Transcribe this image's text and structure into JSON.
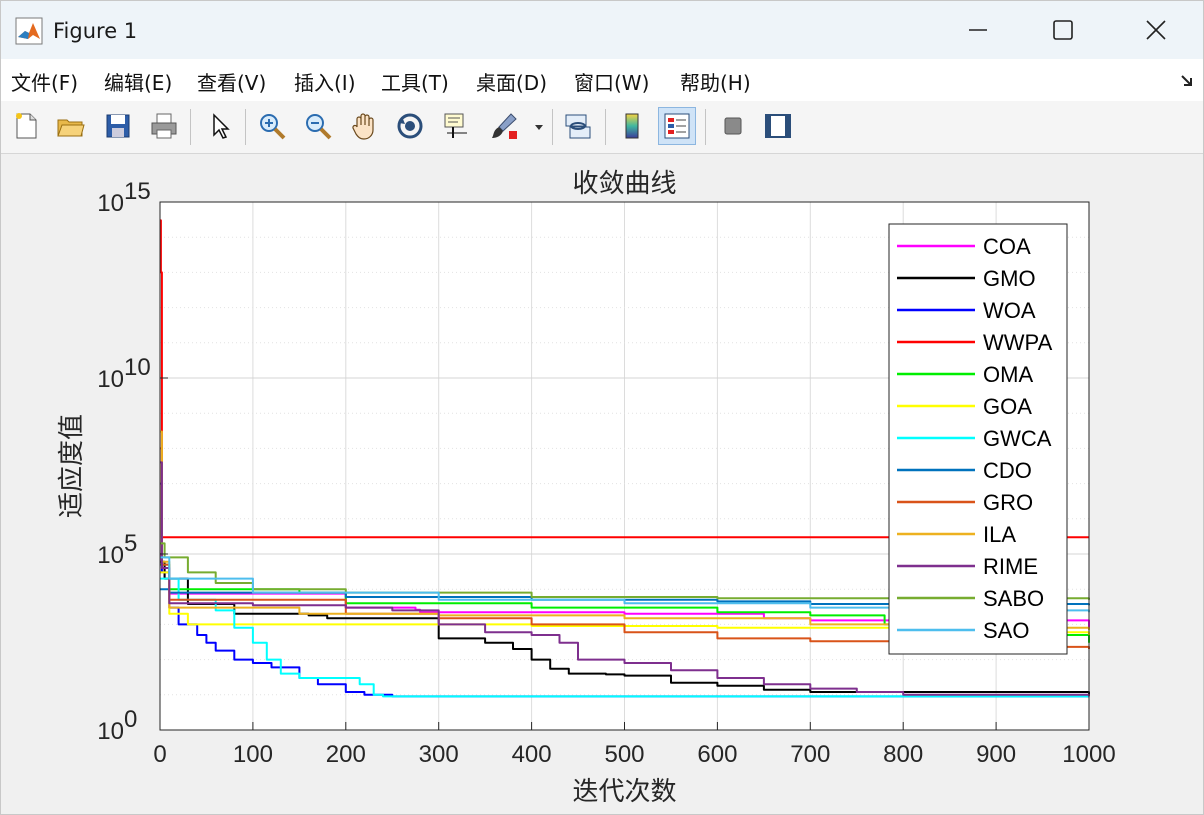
{
  "window": {
    "title": "Figure 1",
    "icon": "matlab-icon",
    "controls": [
      "minimize-icon",
      "maximize-icon",
      "close-icon"
    ]
  },
  "menu": [
    {
      "label": "文件(F)"
    },
    {
      "label": "编辑(E)"
    },
    {
      "label": "查看(V)"
    },
    {
      "label": "插入(I)"
    },
    {
      "label": "工具(T)"
    },
    {
      "label": "桌面(D)"
    },
    {
      "label": "窗口(W)"
    },
    {
      "label": "帮助(H)"
    }
  ],
  "toolbar": {
    "icons": [
      "new-figure-icon",
      "open-icon",
      "save-icon",
      "print-icon",
      "edit-plot-icon",
      "zoom-in-icon",
      "zoom-out-icon",
      "pan-icon",
      "rotate-3d-icon",
      "data-cursor-icon",
      "brush-icon",
      "link-plot-icon",
      "colorbar-icon",
      "legend-icon",
      "hide-plot-tools-icon",
      "show-plot-tools-icon"
    ],
    "active": "legend-icon"
  },
  "chart_data": {
    "type": "line",
    "title": "收敛曲线",
    "xlabel": "迭代次数",
    "ylabel": "适应度值",
    "xlim": [
      0,
      1000
    ],
    "ylim_log10": [
      0,
      15
    ],
    "yscale": "log",
    "grid": true,
    "xticks": [
      "0",
      "100",
      "200",
      "300",
      "400",
      "500",
      "600",
      "700",
      "800",
      "900",
      "1000"
    ],
    "yticks": [
      {
        "base": "10",
        "exp": "0"
      },
      {
        "base": "10",
        "exp": "5"
      },
      {
        "base": "10",
        "exp": "10"
      },
      {
        "base": "10",
        "exp": "15"
      }
    ],
    "legend_position": "top-right",
    "series": [
      {
        "name": "COA",
        "color": "#ff00ff",
        "points": [
          [
            0,
            100000
          ],
          [
            1,
            50000
          ],
          [
            5,
            20000
          ],
          [
            10,
            7500
          ],
          [
            200,
            3000
          ],
          [
            275,
            2600
          ],
          [
            280,
            2200
          ],
          [
            500,
            2000
          ],
          [
            650,
            1500
          ],
          [
            700,
            1300
          ],
          [
            1000,
            800
          ]
        ]
      },
      {
        "name": "GMO",
        "color": "#000000",
        "points": [
          [
            0,
            60000
          ],
          [
            5,
            20000
          ],
          [
            30,
            3800
          ],
          [
            80,
            2000
          ],
          [
            160,
            1800
          ],
          [
            180,
            1500
          ],
          [
            300,
            400
          ],
          [
            350,
            300
          ],
          [
            380,
            200
          ],
          [
            400,
            100
          ],
          [
            420,
            55
          ],
          [
            440,
            40
          ],
          [
            480,
            38
          ],
          [
            500,
            35
          ],
          [
            550,
            22
          ],
          [
            600,
            18
          ],
          [
            650,
            14
          ],
          [
            700,
            12
          ],
          [
            1000,
            10
          ]
        ]
      },
      {
        "name": "WOA",
        "color": "#0000ff",
        "points": [
          [
            0,
            10000000
          ],
          [
            2,
            30000
          ],
          [
            10,
            3000
          ],
          [
            20,
            1000
          ],
          [
            40,
            500
          ],
          [
            50,
            300
          ],
          [
            60,
            180
          ],
          [
            80,
            100
          ],
          [
            100,
            80
          ],
          [
            120,
            60
          ],
          [
            150,
            30
          ],
          [
            170,
            20
          ],
          [
            200,
            12
          ],
          [
            220,
            10
          ],
          [
            250,
            9
          ],
          [
            1000,
            9
          ]
        ]
      },
      {
        "name": "WWPA",
        "color": "#ff0000",
        "points": [
          [
            0,
            300000000000000.0
          ],
          [
            1,
            10000000000000.0
          ],
          [
            2,
            300000
          ],
          [
            1000,
            300000
          ]
        ]
      },
      {
        "name": "OMA",
        "color": "#00ee00",
        "points": [
          [
            0,
            50000
          ],
          [
            10,
            10000
          ],
          [
            150,
            8000
          ],
          [
            200,
            4000
          ],
          [
            400,
            3000
          ],
          [
            600,
            2200
          ],
          [
            700,
            1800
          ],
          [
            780,
            1000
          ],
          [
            850,
            500
          ],
          [
            1000,
            300
          ]
        ]
      },
      {
        "name": "GOA",
        "color": "#ffff00",
        "points": [
          [
            0,
            30000
          ],
          [
            10,
            2000
          ],
          [
            30,
            1000
          ],
          [
            200,
            1000
          ],
          [
            400,
            900
          ],
          [
            600,
            800
          ],
          [
            800,
            600
          ],
          [
            1000,
            500
          ]
        ]
      },
      {
        "name": "GWCA",
        "color": "#00ffff",
        "points": [
          [
            0,
            20000
          ],
          [
            20,
            5000
          ],
          [
            60,
            2500
          ],
          [
            80,
            800
          ],
          [
            100,
            300
          ],
          [
            115,
            100
          ],
          [
            130,
            40
          ],
          [
            150,
            30
          ],
          [
            200,
            30
          ],
          [
            215,
            20
          ],
          [
            230,
            10
          ],
          [
            240,
            9
          ],
          [
            1000,
            9
          ]
        ]
      },
      {
        "name": "CDO",
        "color": "#0072bd",
        "points": [
          [
            0,
            10000
          ],
          [
            10,
            8000
          ],
          [
            200,
            6000
          ],
          [
            400,
            5000
          ],
          [
            600,
            4500
          ],
          [
            700,
            3800
          ],
          [
            1000,
            3500
          ]
        ]
      },
      {
        "name": "GRO",
        "color": "#d95319",
        "points": [
          [
            0,
            100000000.0
          ],
          [
            2,
            50000
          ],
          [
            10,
            5000
          ],
          [
            200,
            2000
          ],
          [
            300,
            1500
          ],
          [
            400,
            1000
          ],
          [
            500,
            600
          ],
          [
            600,
            400
          ],
          [
            700,
            330
          ],
          [
            800,
            280
          ],
          [
            900,
            230
          ],
          [
            1000,
            200
          ]
        ]
      },
      {
        "name": "ILA",
        "color": "#edb120",
        "points": [
          [
            0,
            300000000.0
          ],
          [
            2,
            60000
          ],
          [
            10,
            3000
          ],
          [
            150,
            2000
          ],
          [
            300,
            1800
          ],
          [
            500,
            1500
          ],
          [
            700,
            1000
          ],
          [
            850,
            800
          ],
          [
            1000,
            700
          ]
        ]
      },
      {
        "name": "RIME",
        "color": "#7e2f8e",
        "points": [
          [
            0,
            40000000.0
          ],
          [
            2,
            40000
          ],
          [
            10,
            4000
          ],
          [
            100,
            3500
          ],
          [
            200,
            3000
          ],
          [
            250,
            2500
          ],
          [
            300,
            1000
          ],
          [
            350,
            600
          ],
          [
            400,
            500
          ],
          [
            430,
            300
          ],
          [
            450,
            100
          ],
          [
            500,
            80
          ],
          [
            550,
            50
          ],
          [
            600,
            30
          ],
          [
            650,
            20
          ],
          [
            700,
            15
          ],
          [
            750,
            12
          ],
          [
            800,
            10
          ],
          [
            1000,
            9
          ]
        ]
      },
      {
        "name": "SABO",
        "color": "#77ac30",
        "points": [
          [
            0,
            200000
          ],
          [
            5,
            80000
          ],
          [
            30,
            30000
          ],
          [
            60,
            15000
          ],
          [
            100,
            10000
          ],
          [
            200,
            8000
          ],
          [
            400,
            6000
          ],
          [
            600,
            5500
          ],
          [
            1000,
            5000
          ]
        ]
      },
      {
        "name": "SAO",
        "color": "#4dbeee",
        "points": [
          [
            0,
            80000
          ],
          [
            10,
            20000
          ],
          [
            100,
            8000
          ],
          [
            300,
            5000
          ],
          [
            500,
            4000
          ],
          [
            700,
            3000
          ],
          [
            900,
            2500
          ],
          [
            1000,
            2200
          ]
        ]
      }
    ]
  }
}
